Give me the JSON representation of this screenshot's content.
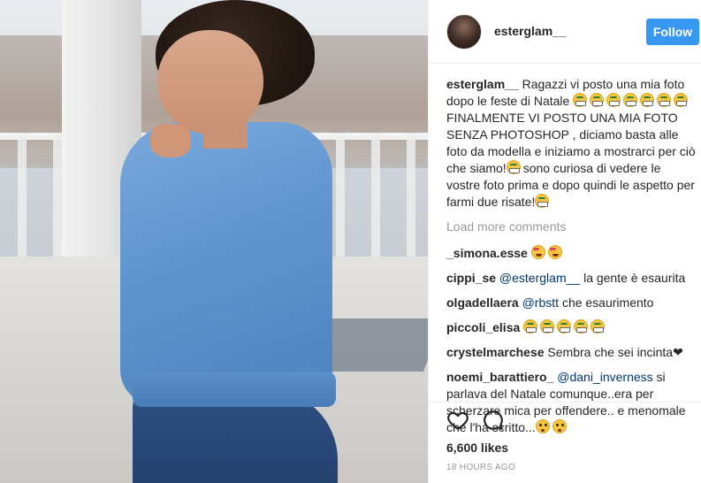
{
  "post": {
    "username": "esterglam__",
    "follow_label": "Follow",
    "caption": {
      "username": "esterglam__",
      "text_1": "Ragazzi vi posto una mia foto dopo le feste di Natale",
      "text_2": "FINALMENTE VI POSTO UNA MIA FOTO SENZA PHOTOSHOP , diciamo basta alle foto da modella e iniziamo a mostrarci per ciò che siamo!",
      "text_3": "sono curiosa di vedere le vostre foto prima e dopo quindi le aspetto per farmi due risate!"
    },
    "load_more": "Load more comments",
    "comments": [
      {
        "username": "_simona.esse",
        "mention": "",
        "text": ""
      },
      {
        "username": "cippi_se",
        "mention": "@esterglam__",
        "text": "la gente è esaurita"
      },
      {
        "username": "olgadellaera",
        "mention": "@rbstt",
        "text": "che esaurimento"
      },
      {
        "username": "piccoli_elisa",
        "mention": "",
        "text": ""
      },
      {
        "username": "crystelmarchese",
        "mention": "",
        "text": "Sembra che sei incinta"
      },
      {
        "username": "noemi_barattiero_",
        "mention": "@dani_inverness",
        "text": "si parlava del Natale comunque..era per scherzare mica per offendere.. e menomale che l'ha scritto..."
      }
    ],
    "likes": "6,600 likes",
    "timestamp": "18 HOURS AGO"
  },
  "icons": {
    "heart": "heart-outline-icon",
    "comment": "comment-bubble-icon"
  }
}
